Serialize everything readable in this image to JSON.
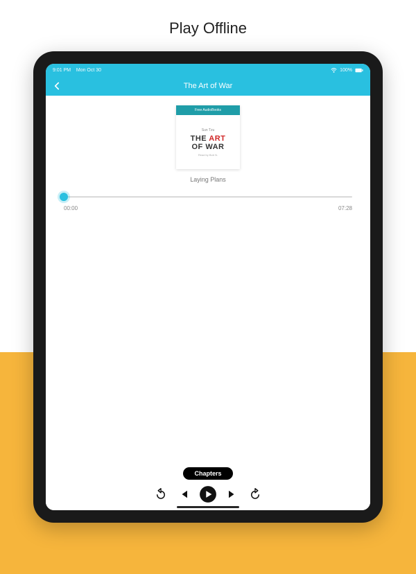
{
  "promo": {
    "title": "Play Offline"
  },
  "status": {
    "time": "9:01 PM",
    "date": "Mon Oct 30",
    "wifi_icon": "wifi",
    "battery": "100%"
  },
  "header": {
    "title": "The Art of War"
  },
  "cover": {
    "brand": "Free AudioBooks",
    "author": "Sun Tzu",
    "title_word1": "THE",
    "title_word2": "ART",
    "title_line2": "OF WAR",
    "subtitle": "Read by Bob N."
  },
  "player": {
    "chapter": "Laying Plans",
    "elapsed": "00:00",
    "duration": "07:28",
    "chapters_label": "Chapters"
  },
  "colors": {
    "accent": "#29c0e0",
    "promo_bg": "#f6b53c",
    "danger": "#d02727"
  }
}
